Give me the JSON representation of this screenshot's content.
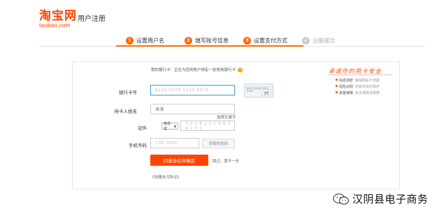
{
  "header": {
    "logo_main": "淘宝网",
    "logo_sub": "taobao.com",
    "page_title": "用户注册"
  },
  "steps": [
    {
      "num": "1",
      "label": "设置用户名"
    },
    {
      "num": "2",
      "label": "填写账号信息"
    },
    {
      "num": "3",
      "label": "设置支付方式"
    },
    {
      "num": "✓",
      "label": "注册成功"
    }
  ],
  "form": {
    "top_tip": "我的银行卡：正在为您的账户绑定一张常用银行卡",
    "card_label": "银行卡号",
    "card_value": "6222 0200 1234 5678",
    "card_preview_number": "XXXX XXXX XXXX XXXX",
    "card_preview_tag": "银联",
    "holder_label": "持卡人姓名",
    "holder_value": "淮淮",
    "rare_char_link": "选择生僻字",
    "id_label": "证件",
    "id_type": "身份证",
    "id_value": "3 2 0 8 2 6 1 9 8 5 0 1 0 1",
    "phone_label": "手机号码",
    "phone_value": "138 0000",
    "sms_button": "获取校验码",
    "submit_button": "同意协议并确定",
    "skip_link": "跳过，暂不一步",
    "agreement_link": "《快捷支付协议》"
  },
  "safety": {
    "title": "承诺你的用卡安全",
    "items": [
      {
        "k": "信息加密",
        "v": "确保隐私不泄露"
      },
      {
        "k": "风险识别",
        "v": "防欺诈实时保护"
      },
      {
        "k": "资金保障",
        "v": "安全保障全额赔"
      }
    ]
  },
  "watermark": {
    "text": "汉阴县电子商务"
  },
  "colors": {
    "brand": "#ff4400",
    "step_active": "#ff6a00",
    "focus_border": "#4ea3dc"
  }
}
